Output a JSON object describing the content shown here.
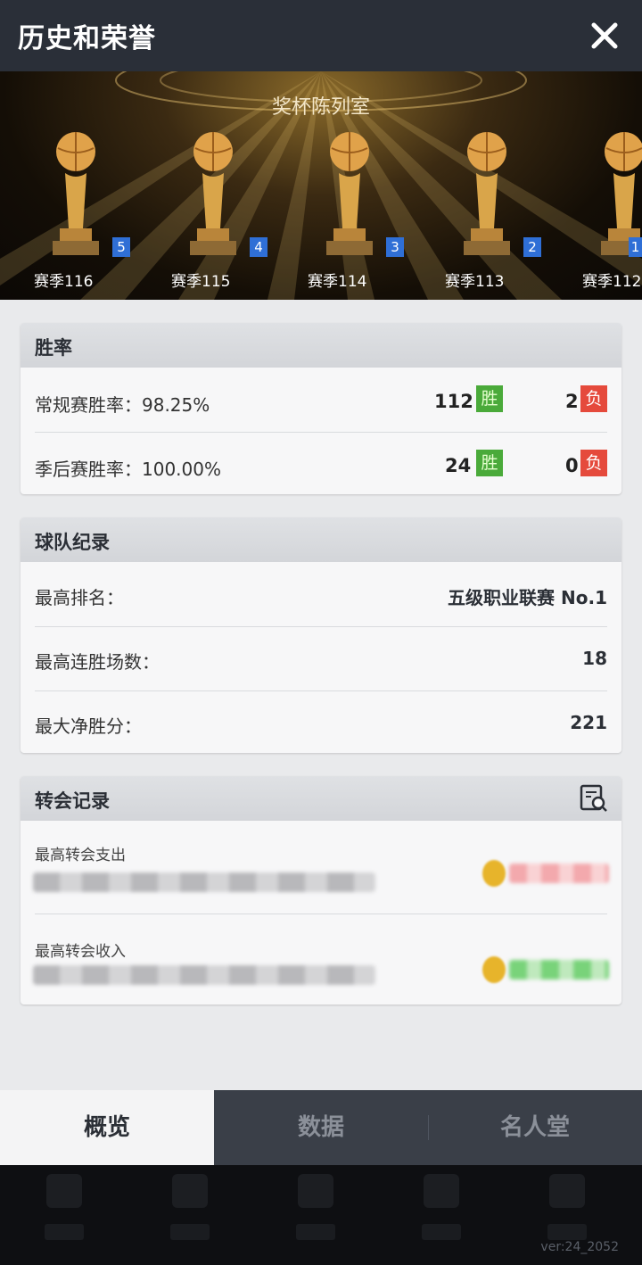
{
  "header": {
    "title": "历史和荣誉",
    "close_icon": "close-icon"
  },
  "banner": {
    "caption": "奖杯陈列室",
    "trophies": [
      {
        "rank": "5",
        "season": "赛季116"
      },
      {
        "rank": "4",
        "season": "赛季115"
      },
      {
        "rank": "3",
        "season": "赛季114"
      },
      {
        "rank": "2",
        "season": "赛季113"
      },
      {
        "rank": "1",
        "season": "赛季112"
      }
    ]
  },
  "winrate": {
    "title": "胜率",
    "regular": {
      "label": "常规赛胜率：98.25%",
      "wins": "112",
      "win_tag": "胜",
      "losses": "2",
      "loss_tag": "负"
    },
    "playoff": {
      "label": "季后赛胜率：100.00%",
      "wins": "24",
      "win_tag": "胜",
      "losses": "0",
      "loss_tag": "负"
    }
  },
  "team_record": {
    "title": "球队纪录",
    "rows": [
      {
        "label": "最高排名：",
        "value": "五级职业联赛 No.1"
      },
      {
        "label": "最高连胜场数：",
        "value": "18"
      },
      {
        "label": "最大净胜分：",
        "value": "221"
      }
    ]
  },
  "transfer": {
    "title": "转会记录",
    "icon": "search-record-icon",
    "rows": [
      {
        "label": "最高转会支出"
      },
      {
        "label": "最高转会收入"
      }
    ]
  },
  "tabs": [
    "概览",
    "数据",
    "名人堂"
  ],
  "version": "ver:24_2052",
  "colors": {
    "win": "#4aaa3a",
    "loss": "#e54a3c",
    "badge": "#2f6fd6"
  }
}
